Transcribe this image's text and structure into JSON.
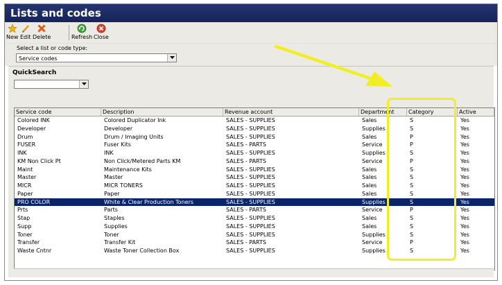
{
  "window": {
    "title": "Lists and codes"
  },
  "toolbar": {
    "buttons": [
      {
        "label": "New",
        "icon": "star-icon"
      },
      {
        "label": "Edit",
        "icon": "pencil-icon"
      },
      {
        "label": "Delete",
        "icon": "delete-x-icon"
      },
      {
        "label": "Refresh",
        "icon": "refresh-icon"
      },
      {
        "label": "Close",
        "icon": "close-icon"
      }
    ]
  },
  "list_selector": {
    "label": "Select a list or code type:",
    "value": "Service codes"
  },
  "quicksearch": {
    "label": "QuickSearch",
    "value": ""
  },
  "grid": {
    "columns": [
      "Service code",
      "Description",
      "Revenue account",
      "Department",
      "Category",
      "Active"
    ],
    "rows": [
      [
        "Colored INK",
        "Colored Duplicator Ink",
        "SALES - SUPPLIES",
        "Sales",
        "S",
        "Yes"
      ],
      [
        "Developer",
        "Developer",
        "SALES - SUPPLIES",
        "Supplies",
        "S",
        "Yes"
      ],
      [
        "Drum",
        "Drum / Imaging Units",
        "SALES - SUPPLIES",
        "Sales",
        "P",
        "Yes"
      ],
      [
        "FUSER",
        "Fuser Kits",
        "SALES - PARTS",
        "Service",
        "P",
        "Yes"
      ],
      [
        "INK",
        "INK",
        "SALES - SUPPLIES",
        "Supplies",
        "S",
        "Yes"
      ],
      [
        "KM Non Click Pt",
        "Non Click/Metered Parts KM",
        "SALES - PARTS",
        "Service",
        "P",
        "Yes"
      ],
      [
        "Maint",
        "Maintenance Kits",
        "SALES - SUPPLIES",
        "Sales",
        "S",
        "Yes"
      ],
      [
        "Master",
        "Master",
        "SALES - SUPPLIES",
        "Sales",
        "S",
        "Yes"
      ],
      [
        "MICR",
        "MICR TONERS",
        "SALES - SUPPLIES",
        "Sales",
        "S",
        "Yes"
      ],
      [
        "Paper",
        "Paper",
        "SALES - SUPPLIES",
        "Sales",
        "S",
        "Yes"
      ],
      [
        "PRO COLOR",
        "White & Clear Production Toners",
        "SALES - SUPPLIES",
        "Supplies",
        "S",
        "Yes"
      ],
      [
        "Prts",
        "Parts",
        "SALES - PARTS",
        "Service",
        "P",
        "Yes"
      ],
      [
        "Stap",
        "Staples",
        "SALES - SUPPLIES",
        "Sales",
        "S",
        "Yes"
      ],
      [
        "Supp",
        "Supplies",
        "SALES - SUPPLIES",
        "Sales",
        "S",
        "Yes"
      ],
      [
        "Toner",
        "Toner",
        "SALES - SUPPLIES",
        "Supplies",
        "S",
        "Yes"
      ],
      [
        "Transfer",
        "Transfer Kit",
        "SALES - PARTS",
        "Service",
        "P",
        "Yes"
      ],
      [
        "Waste Cntnr",
        "Waste Toner Collection Box",
        "SALES - SUPPLIES",
        "Supplies",
        "S",
        "Yes"
      ]
    ],
    "selected_row": 10
  },
  "annotation": {
    "highlight_color": "#f3ee24",
    "target_column": "Category"
  },
  "colors": {
    "title_bar": "#1e2b66",
    "selection": "#0a246a",
    "panel": "#eceae4"
  }
}
